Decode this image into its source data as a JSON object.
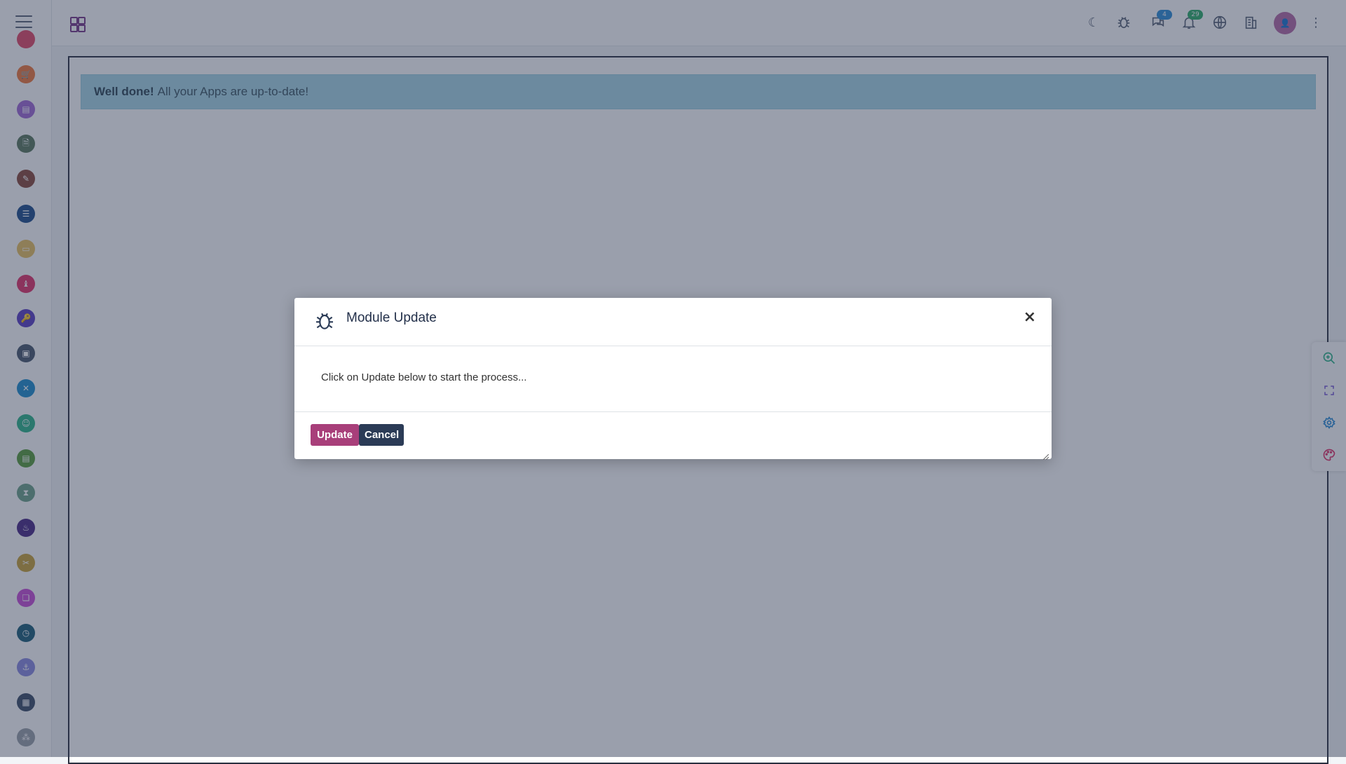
{
  "topbar": {
    "messages_badge": "4",
    "notifications_badge": "29",
    "icons": [
      "moon-icon",
      "bug-icon",
      "chat-icon",
      "bell-icon",
      "globe-icon",
      "building-icon",
      "avatar",
      "kebab-menu-icon"
    ]
  },
  "sidebar": {
    "apps": [
      {
        "color": "#e24a68",
        "glyph": ""
      },
      {
        "color": "#f07a3e",
        "glyph": "🛒"
      },
      {
        "color": "#a16ad6",
        "glyph": "▤"
      },
      {
        "color": "#5b7a5f",
        "glyph": "🗎"
      },
      {
        "color": "#8a4b3e",
        "glyph": "✎"
      },
      {
        "color": "#1f4e8c",
        "glyph": "☰"
      },
      {
        "color": "#e8c060",
        "glyph": "▭"
      },
      {
        "color": "#e2336b",
        "glyph": "♝"
      },
      {
        "color": "#5b3fc4",
        "glyph": "🔑"
      },
      {
        "color": "#4a5a6e",
        "glyph": "▣"
      },
      {
        "color": "#1f8fce",
        "glyph": "✕"
      },
      {
        "color": "#2fb58a",
        "glyph": "☺"
      },
      {
        "color": "#5a9e3e",
        "glyph": "▤"
      },
      {
        "color": "#6fa38a",
        "glyph": "⧗"
      },
      {
        "color": "#4a2a86",
        "glyph": "♨"
      },
      {
        "color": "#c9a33a",
        "glyph": "✂"
      },
      {
        "color": "#c84ed8",
        "glyph": "❏"
      },
      {
        "color": "#1d5f7a",
        "glyph": "◷"
      },
      {
        "color": "#8a8ae0",
        "glyph": "⚓"
      },
      {
        "color": "#3e4e68",
        "glyph": "▦"
      },
      {
        "color": "#9aa0a8",
        "glyph": "⁂"
      }
    ]
  },
  "alert": {
    "strong": "Well done!",
    "text": "All your Apps are up-to-date!"
  },
  "modal": {
    "title": "Module Update",
    "body": "Click on Update below to start the process...",
    "update_label": "Update",
    "cancel_label": "Cancel",
    "close_glyph": "×"
  },
  "floatbar": {
    "items": [
      "zoom-in-icon",
      "expand-icon",
      "settings-icon",
      "palette-icon"
    ]
  },
  "colors": {
    "accent": "#a83f7a",
    "dark": "#2b3b56",
    "alert_bg": "#a9d8e6"
  }
}
